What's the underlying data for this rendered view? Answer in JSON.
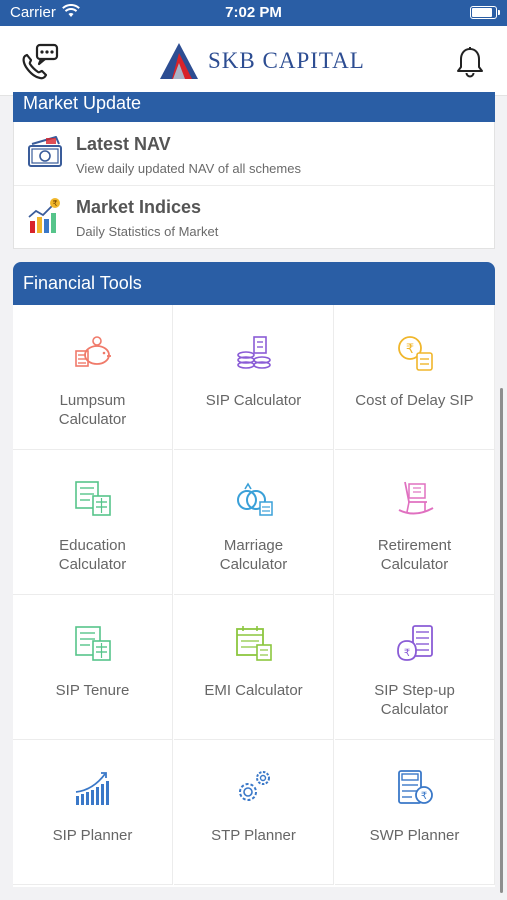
{
  "status_bar": {
    "carrier": "Carrier",
    "time": "7:02 PM"
  },
  "header": {
    "logo_text": "SKB CAPITAL"
  },
  "market_update": {
    "title": "Market Update",
    "items": [
      {
        "name": "Latest NAV",
        "description": "View daily updated NAV of all schemes",
        "icon": "banknote-icon"
      },
      {
        "name": "Market Indices",
        "description": "Daily Statistics of Market",
        "icon": "market-chart-icon"
      }
    ]
  },
  "financial_tools": {
    "title": "Financial Tools",
    "items": [
      {
        "label": "Lumpsum\nCalculator",
        "icon": "piggy-bank-icon",
        "color": "#f07a6a"
      },
      {
        "label": "SIP Calculator",
        "icon": "coins-stack-icon",
        "color": "#8a5cd6"
      },
      {
        "label": "Cost of Delay SIP",
        "icon": "rupee-calculator-icon",
        "color": "#f0b62b"
      },
      {
        "label": "Education\nCalculator",
        "icon": "education-calculator-icon",
        "color": "#56c48a"
      },
      {
        "label": "Marriage\nCalculator",
        "icon": "rings-icon",
        "color": "#3aa0d8"
      },
      {
        "label": "Retirement\nCalculator",
        "icon": "rocking-chair-icon",
        "color": "#e070c0"
      },
      {
        "label": "SIP Tenure",
        "icon": "tenure-calculator-icon",
        "color": "#56c48a"
      },
      {
        "label": "EMI Calculator",
        "icon": "emi-calendar-icon",
        "color": "#8cc63f"
      },
      {
        "label": "SIP Step-up\nCalculator",
        "icon": "stepup-calculator-icon",
        "color": "#8a5cd6"
      },
      {
        "label": "SIP Planner",
        "icon": "growth-bars-icon",
        "color": "#3a78c8"
      },
      {
        "label": "STP Planner",
        "icon": "gears-icon",
        "color": "#3a78c8"
      },
      {
        "label": "SWP Planner",
        "icon": "swp-calculator-icon",
        "color": "#3a78c8"
      }
    ]
  }
}
